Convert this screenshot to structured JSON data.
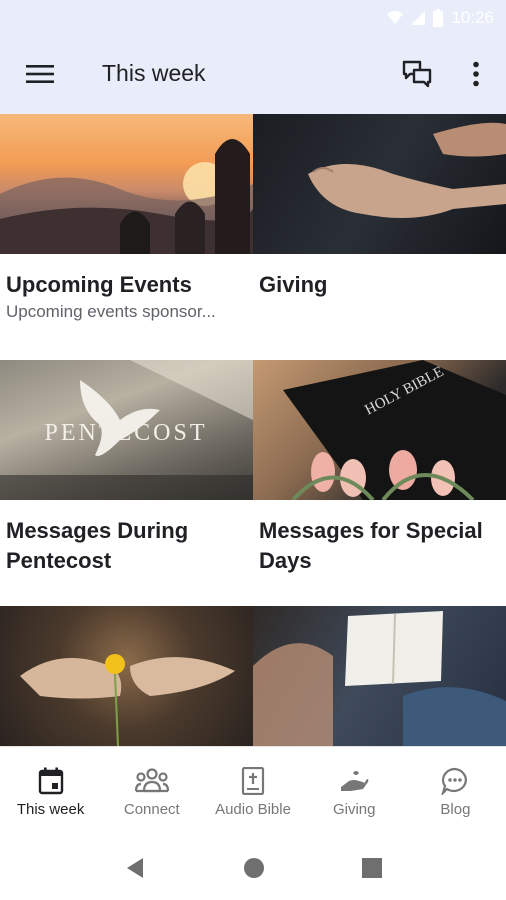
{
  "status_bar": {
    "time": "10:26"
  },
  "app_bar": {
    "title": "This week"
  },
  "cards": [
    {
      "title": "Upcoming Events",
      "subtitle": "Upcoming events sponsor..."
    },
    {
      "title": "Giving",
      "subtitle": ""
    },
    {
      "title": "Messages During Pentecost",
      "subtitle": ""
    },
    {
      "title": "Messages for Special Days",
      "subtitle": ""
    },
    {
      "title": "",
      "subtitle": ""
    },
    {
      "title": "",
      "subtitle": ""
    }
  ],
  "images": {
    "pentecost_text": "PENTECOST",
    "bible_text": "HOLY BIBLE"
  },
  "bottom_nav": [
    {
      "label": "This week",
      "icon": "calendar-icon",
      "active": true
    },
    {
      "label": "Connect",
      "icon": "people-icon",
      "active": false
    },
    {
      "label": "Audio Bible",
      "icon": "bible-icon",
      "active": false
    },
    {
      "label": "Giving",
      "icon": "giving-hand-icon",
      "active": false
    },
    {
      "label": "Blog",
      "icon": "chat-bubble-icon",
      "active": false
    }
  ],
  "colors": {
    "app_bar_bg": "#e9edf9",
    "text_primary": "#202124",
    "text_secondary": "#5f6368",
    "nav_inactive": "#777777"
  }
}
